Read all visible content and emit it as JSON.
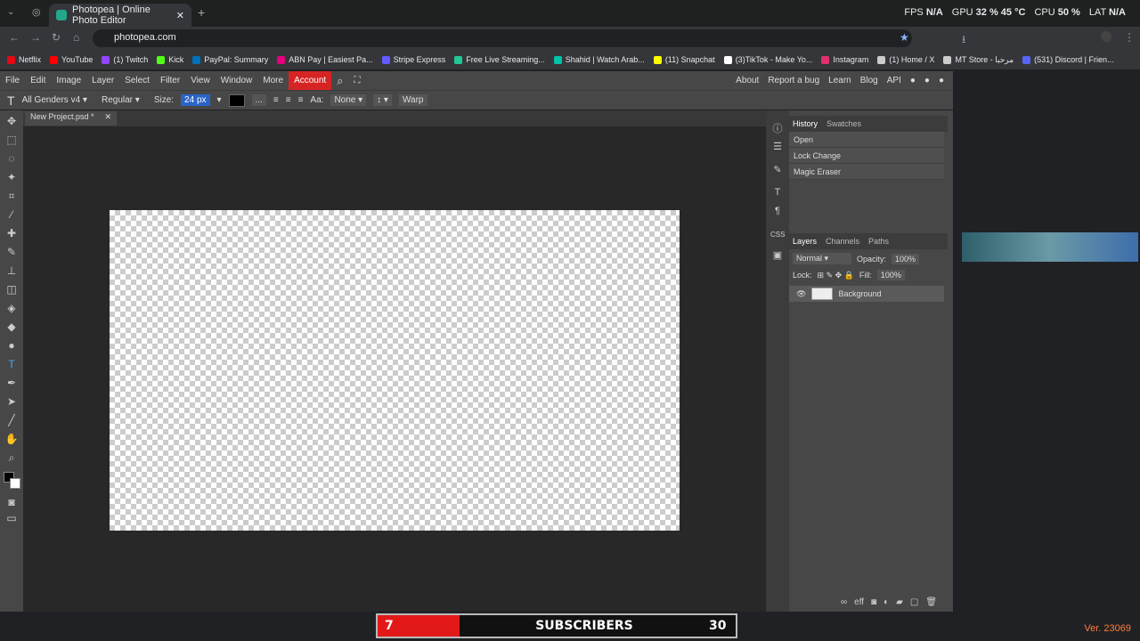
{
  "browser": {
    "tab_title": "Photopea | Online Photo Editor",
    "url": "photopea.com",
    "stats": {
      "fps_label": "FPS",
      "fps": "N/A",
      "gpu_label": "GPU",
      "gpu": "32 % 45 °C",
      "cpu_label": "CPU",
      "cpu": "50 %",
      "lat_label": "LAT",
      "lat": "N/A"
    },
    "bookmarks": [
      "Netflix",
      "YouTube",
      "(1) Twitch",
      "Kick",
      "PayPal: Summary",
      "ABN Pay | Easiest Pa...",
      "Stripe Express",
      "Free Live Streaming...",
      "Shahid | Watch Arab...",
      "(11) Snapchat",
      "(3)TikTok - Make Yo...",
      "Instagram",
      "(1) Home / X",
      "MT Store - مرحبا",
      "(531) Discord | Frien..."
    ]
  },
  "menu": {
    "items": [
      "File",
      "Edit",
      "Image",
      "Layer",
      "Select",
      "Filter",
      "View",
      "Window",
      "More"
    ],
    "account": "Account",
    "right": [
      "About",
      "Report a bug",
      "Learn",
      "Blog",
      "API"
    ]
  },
  "options": {
    "font": "All Genders v4",
    "style": "Regular",
    "size_label": "Size:",
    "size": "24 px",
    "more": "...",
    "aa_label": "Aa:",
    "aa": "None",
    "warp": "Warp"
  },
  "document": {
    "tab": "New Project.psd *"
  },
  "history": {
    "tabs": [
      "History",
      "Swatches"
    ],
    "items": [
      "Open",
      "Lock Change",
      "Magic Eraser"
    ]
  },
  "layers": {
    "tabs": [
      "Layers",
      "Channels",
      "Paths"
    ],
    "blend": "Normal",
    "opacity_label": "Opacity:",
    "opacity": "100%",
    "lock_label": "Lock:",
    "fill_label": "Fill:",
    "fill": "100%",
    "layer_name": "Background"
  },
  "side_icons": [
    "CSS"
  ],
  "subscriber_bar": {
    "left": "7",
    "label": "SUBSCRIBERS",
    "right": "30"
  },
  "version": "Ver. 23069"
}
